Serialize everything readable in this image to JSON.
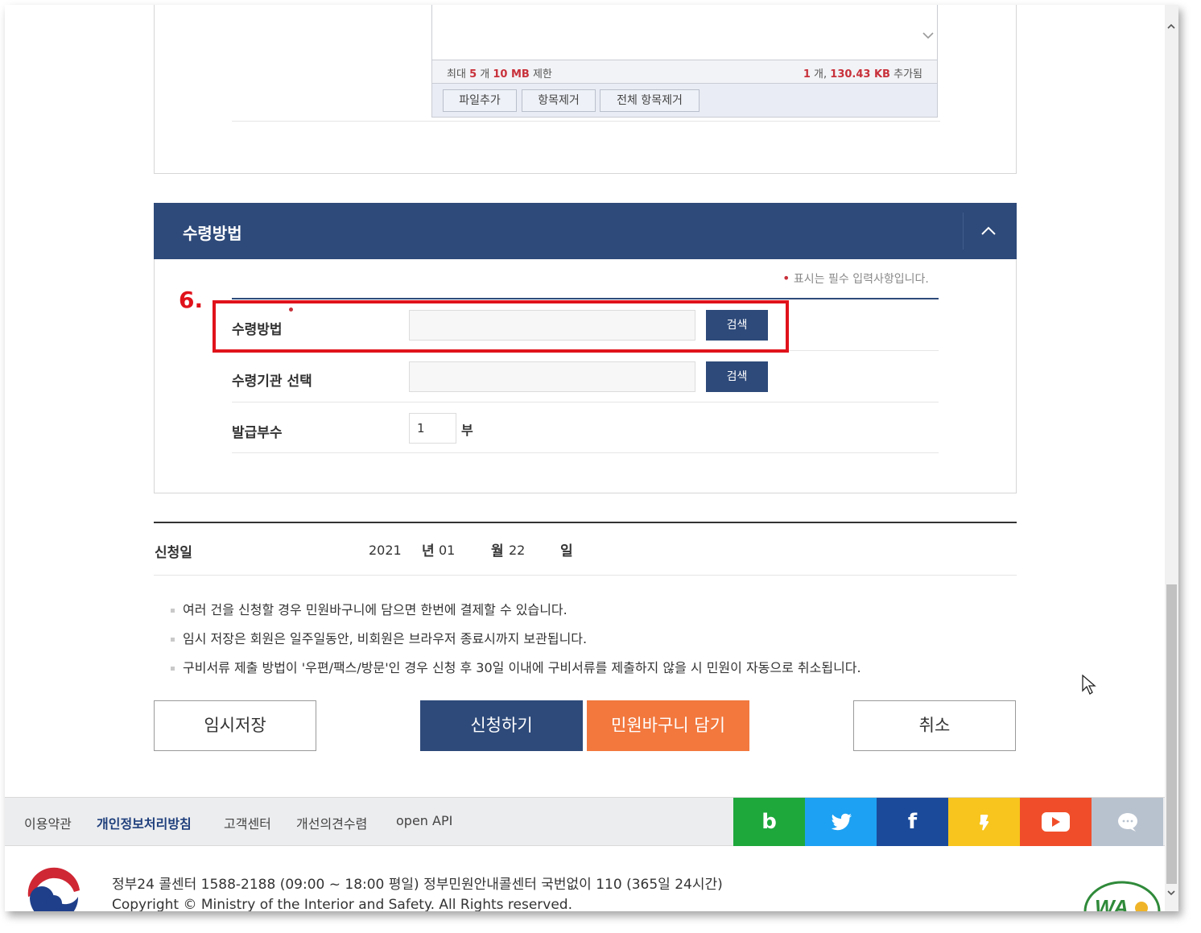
{
  "attachment": {
    "limit_prefix": "최대",
    "limit_count": "5",
    "limit_count_unit": "개",
    "limit_size": "10 MB",
    "limit_suffix": "제한",
    "added_count": "1",
    "added_count_unit": "개,",
    "added_size": "130.43 KB",
    "added_suffix": "추가됨",
    "buttons": {
      "add": "파일추가",
      "remove": "항목제거",
      "remove_all": "전체 항목제거"
    }
  },
  "section": {
    "title": "수령방법",
    "required_note": "표시는 필수 입력사항입니다.",
    "annotation_step": "6.",
    "rows": {
      "method": {
        "label": "수령방법",
        "value": "",
        "button": "검색"
      },
      "agency": {
        "label": "수령기관 선택",
        "value": "",
        "button": "검색"
      },
      "copies": {
        "label": "발급부수",
        "value": "1",
        "unit": "부"
      }
    }
  },
  "application_date": {
    "label": "신청일",
    "year": "2021",
    "year_unit": "년",
    "month": "01",
    "month_unit": "월",
    "day": "22",
    "day_unit": "일"
  },
  "notes": [
    "여러 건을 신청할 경우 민원바구니에 담으면 한번에 결제할 수 있습니다.",
    "임시 저장은 회원은 일주일동안, 비회원은 브라우저 종료시까지 보관됩니다.",
    "구비서류 제출 방법이 '우편/팩스/방문'인 경우 신청 후 30일 이내에 구비서류를 제출하지 않을 시 민원이 자동으로 취소됩니다."
  ],
  "actions": {
    "temp_save": "임시저장",
    "apply": "신청하기",
    "add_basket": "민원바구니 담기",
    "cancel": "취소"
  },
  "footer": {
    "links": [
      "이용약관",
      "개인정보처리방침",
      "고객센터",
      "개선의견수렴",
      "open API"
    ],
    "social": [
      {
        "name": "blog-icon",
        "glyph": "b",
        "color": "#1ea83c"
      },
      {
        "name": "twitter-icon",
        "glyph": "",
        "color": "#1da1f2"
      },
      {
        "name": "facebook-icon",
        "glyph": "f",
        "color": "#1b4a9a"
      },
      {
        "name": "kakaostory-icon",
        "glyph": "",
        "color": "#f7c51d"
      },
      {
        "name": "youtube-icon",
        "glyph": "",
        "color": "#f04e2a"
      },
      {
        "name": "talk-icon",
        "glyph": "",
        "color": "#b8c2cf"
      }
    ],
    "contact": "정부24 콜센터 1588-2188 (09:00 ~ 18:00 평일) 정부민원안내콜센터 국번없이 110 (365일 24시간)",
    "copyright": "Copyright © Ministry of the Interior and Safety. All Rights reserved.",
    "wa_mark": "WA"
  },
  "colors": {
    "primary": "#2e4a7a",
    "accent_orange": "#f2783e",
    "highlight_red": "#e0121b"
  }
}
